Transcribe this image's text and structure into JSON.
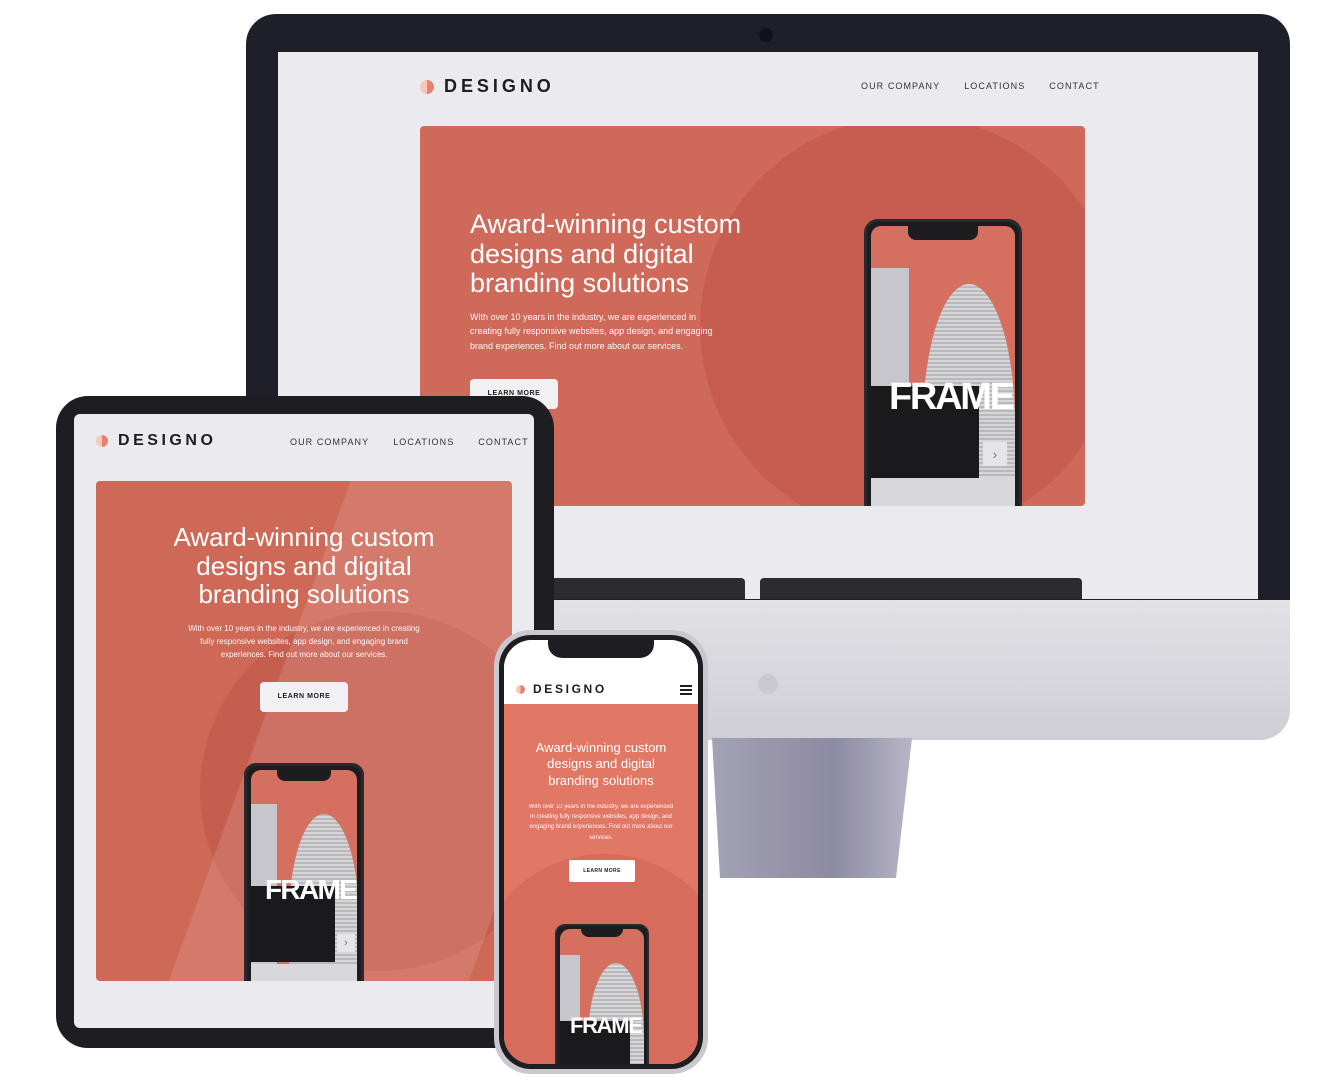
{
  "brand": {
    "name": "DESIGNO",
    "accent": "#cf6a5b",
    "dark": "#1d1c1e"
  },
  "nav": {
    "items": [
      "OUR COMPANY",
      "LOCATIONS",
      "CONTACT"
    ]
  },
  "hero": {
    "title_desktop": [
      "Award-winning custom",
      "designs and digital",
      "branding solutions"
    ],
    "copy_desktop": [
      "With over 10 years in the industry, we are experienced in",
      "creating fully responsive websites, app design, and engaging",
      "brand experiences. Find out more about our services."
    ],
    "copy_tablet": [
      "With over 10 years in the industry, we are experienced in creating",
      "fully responsive websites, app design, and engaging brand",
      "experiences. Find out more about our services."
    ],
    "copy_mobile": [
      "With over 10 years in the industry, we are experienced",
      "in creating fully responsive websites, app design, and",
      "engaging brand experiences. Find out more about our",
      "services."
    ],
    "cta": "LEARN MORE"
  },
  "mockup": {
    "frame_word": "FRAME",
    "arrow": "›"
  },
  "icons": {
    "logo": "designo-logo-icon",
    "menu": "hamburger-menu-icon",
    "apple": "apple-logo-icon",
    "camera": "camera-icon"
  }
}
